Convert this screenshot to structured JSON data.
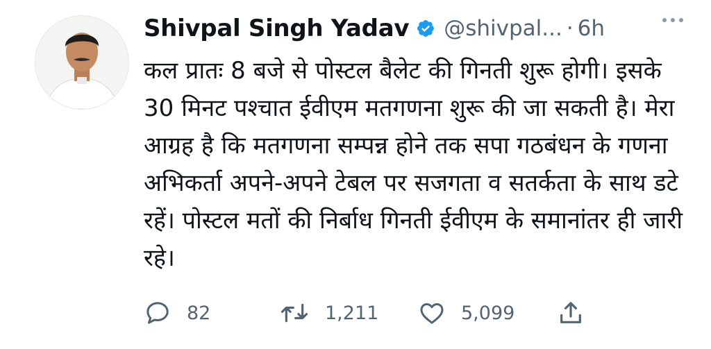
{
  "tweet": {
    "author": {
      "name": "Shivpal Singh Yadav",
      "handle": "@shivpal...",
      "verified": true
    },
    "separator": "·",
    "time": "6h",
    "text": "कल प्रातः 8 बजे से पोस्टल बैलेट की गिनती शुरू होगी। इसके 30 मिनट पश्चात ईवीएम मतगणना शुरू की जा सकती है। मेरा आग्रह है कि मतगणना सम्पन्न होने तक सपा गठबंधन के गणना अभिकर्ता अपने-अपने टेबल पर सजगता व सतर्कता के साथ डटे रहें। पोस्टल मतों की निर्बाध गिनती ईवीएम के समानांतर ही जारी रहे।",
    "stats": {
      "replies": "82",
      "retweets": "1,211",
      "likes": "5,099"
    }
  },
  "icons": {
    "verified": "verified-badge-icon",
    "more": "more-options-icon",
    "reply": "reply-icon",
    "retweet": "retweet-icon",
    "like": "heart-icon",
    "share": "share-icon"
  },
  "colors": {
    "verified": "#1d9bf0",
    "secondary_text": "#536471",
    "text": "#0f1419"
  }
}
